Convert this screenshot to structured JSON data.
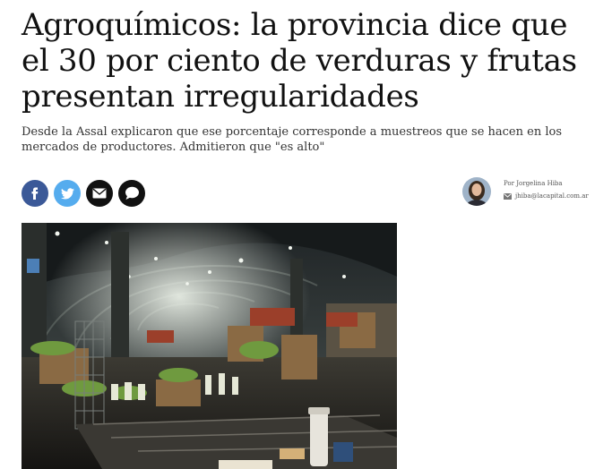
{
  "article": {
    "headline": "Agroquímicos: la provincia dice que el 30 por ciento de verduras y frutas presentan irregularidades",
    "subheadline": "Desde la Assal explicaron que ese porcentaje corresponde a muestreos que se hacen en los mercados de productores. Admitieron que \"es alto\""
  },
  "share": {
    "buttons": [
      {
        "icon": "facebook-icon",
        "color": "#3b5998"
      },
      {
        "icon": "twitter-icon",
        "color": "#55acee"
      },
      {
        "icon": "email-icon",
        "color": "#111111"
      },
      {
        "icon": "comment-icon",
        "color": "#111111"
      }
    ]
  },
  "author": {
    "byline": "Por Jorgelina Hiba",
    "email": "jhiba@lacapital.com.ar",
    "email_icon": "email-icon"
  },
  "photo": {
    "icon": "market-photo"
  }
}
